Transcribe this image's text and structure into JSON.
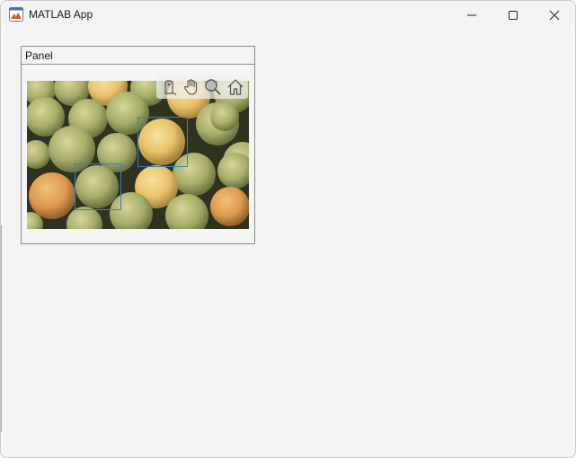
{
  "window": {
    "title": "MATLAB App",
    "minimize_icon": "minimize-icon",
    "maximize_icon": "maximize-icon",
    "close_icon": "close-icon"
  },
  "panel": {
    "title": "Panel"
  },
  "axes_toolbar": {
    "buttons": [
      "data-tip-icon",
      "pan-hand-icon",
      "zoom-in-icon",
      "home-restore-icon"
    ]
  },
  "image": {
    "subject": "photo of yellow-green apples",
    "roi_rectangles": 2,
    "roi_color": "#2f86c9"
  },
  "colors": {
    "titlebar": "#f3f3f3",
    "background": "#f5f5f5",
    "panel_border": "#8c8c8c"
  }
}
